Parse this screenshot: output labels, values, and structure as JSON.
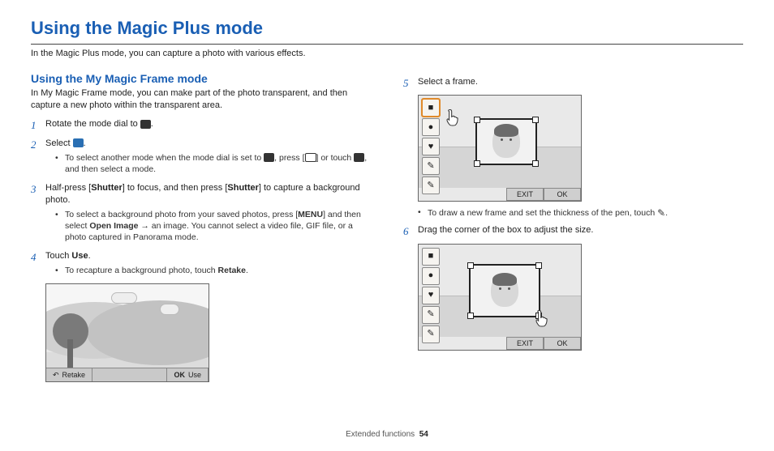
{
  "title": "Using the Magic Plus mode",
  "intro": "In the Magic Plus mode, you can capture a photo with various effects.",
  "section_title": "Using the My Magic Frame mode",
  "section_intro": "In My Magic Frame mode, you can make part of the photo transparent, and then capture a new photo within the transparent area.",
  "steps": {
    "s1": {
      "num": "1",
      "text_a": "Rotate the mode dial to ",
      "text_b": "."
    },
    "s2": {
      "num": "2",
      "text_a": "Select ",
      "text_b": ".",
      "note_a": "To select another mode when the mode dial is set to ",
      "note_b": ", press [",
      "note_c": "] or touch ",
      "note_d": ", and then select a mode."
    },
    "s3": {
      "num": "3",
      "text_a": "Half-press [",
      "shutter1": "Shutter",
      "text_b": "] to focus, and then press [",
      "shutter2": "Shutter",
      "text_c": "] to capture a background photo.",
      "note_a": "To select a background photo from your saved photos, press [",
      "menu": "MENU",
      "note_b": "] and then select ",
      "open_image": "Open Image",
      "note_c": " → an image. You cannot select a video file, GIF file, or a photo captured in Panorama mode."
    },
    "s4": {
      "num": "4",
      "text_a": "Touch ",
      "use": "Use",
      "text_b": ".",
      "note_a": "To recapture a background photo, touch ",
      "retake": "Retake",
      "note_b": "."
    },
    "s5": {
      "num": "5",
      "text": "Select a frame.",
      "note": "To draw a new frame and set the thickness of the pen, touch "
    },
    "s6": {
      "num": "6",
      "text": "Drag the corner of the box to adjust the size."
    }
  },
  "fig_landscape": {
    "btn_retake": "Retake",
    "btn_use": "Use",
    "ok_label": "OK"
  },
  "fig_frame": {
    "tools": [
      "■",
      "●",
      "♥",
      "✎",
      "✎"
    ],
    "exit": "EXIT",
    "ok": "OK"
  },
  "footer": {
    "section": "Extended functions",
    "page": "54"
  }
}
